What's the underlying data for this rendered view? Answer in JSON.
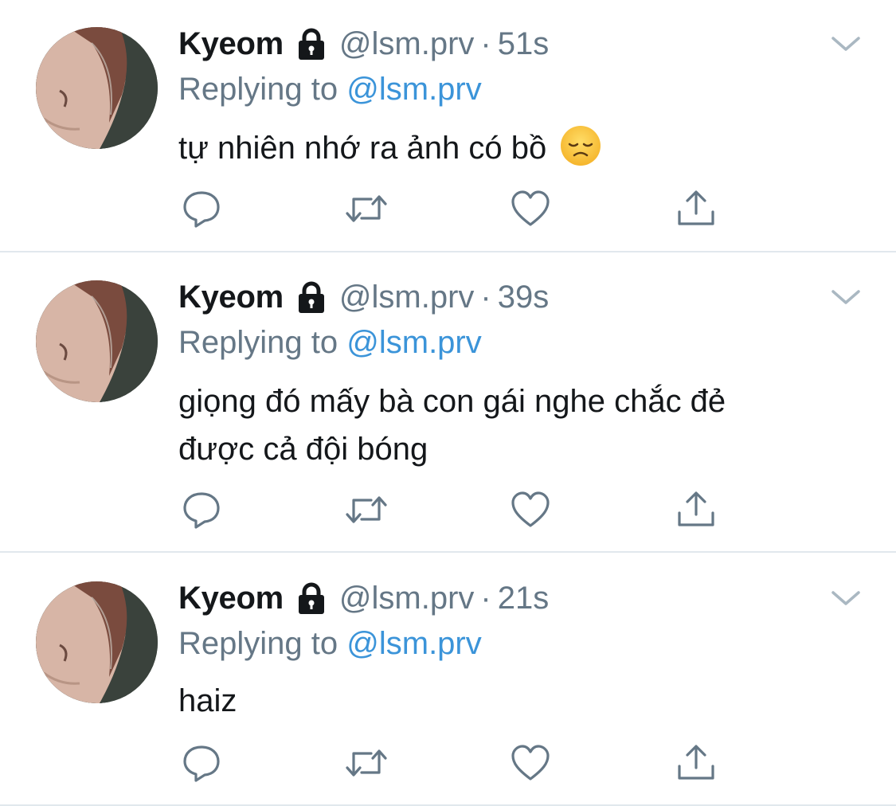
{
  "tweets": [
    {
      "name": "Kyeom",
      "handle": "@lsm.prv",
      "separator": "·",
      "time": "51s",
      "replying_prefix": "Replying to",
      "replying_to": "@lsm.prv",
      "text": "tự nhiên nhớ ra ảnh có bồ",
      "emoji": "disappointed-face-emoji"
    },
    {
      "name": "Kyeom",
      "handle": "@lsm.prv",
      "separator": "·",
      "time": "39s",
      "replying_prefix": "Replying to",
      "replying_to": "@lsm.prv",
      "text_line1": "giọng đó mấy bà con gái nghe chắc đẻ",
      "text_line2": "được cả đội bóng"
    },
    {
      "name": "Kyeom",
      "handle": "@lsm.prv",
      "separator": "·",
      "time": "21s",
      "replying_prefix": "Replying to",
      "replying_to": "@lsm.prv",
      "text": "haiz"
    }
  ],
  "icons": {
    "lock": "lock-icon",
    "menu": "chevron-down-icon",
    "reply": "reply-icon",
    "retweet": "retweet-icon",
    "like": "heart-icon",
    "share": "share-icon"
  },
  "colors": {
    "name": "#14171a",
    "secondary": "#657786",
    "mention": "#3b94d9",
    "divider": "#e1e8ed",
    "icon": "#657786"
  }
}
